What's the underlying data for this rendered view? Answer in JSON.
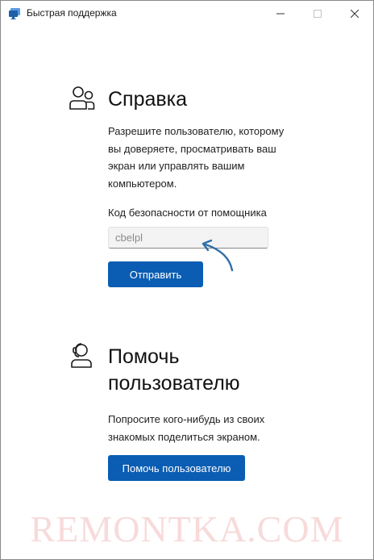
{
  "window": {
    "title": "Быстрая поддержка"
  },
  "get_help": {
    "heading": "Справка",
    "description": "Разрешите пользователю, которому вы доверяете, просматривать ваш экран или управлять вашим компьютером.",
    "code_label": "Код безопасности от помощника",
    "code_value": "cbelpl",
    "submit_label": "Отправить"
  },
  "give_help": {
    "heading": "Помочь пользователю",
    "description": "Попросите кого-нибудь из своих знакомых поделиться экраном.",
    "button_label": "Помочь пользователю"
  },
  "watermark": "REMONTKA.COM",
  "colors": {
    "accent": "#0a5db3",
    "annotation_arrow": "#2f6fa8"
  },
  "icons": {
    "app": "quick-assist-icon",
    "get_help": "people-icon",
    "give_help": "person-headset-icon"
  }
}
